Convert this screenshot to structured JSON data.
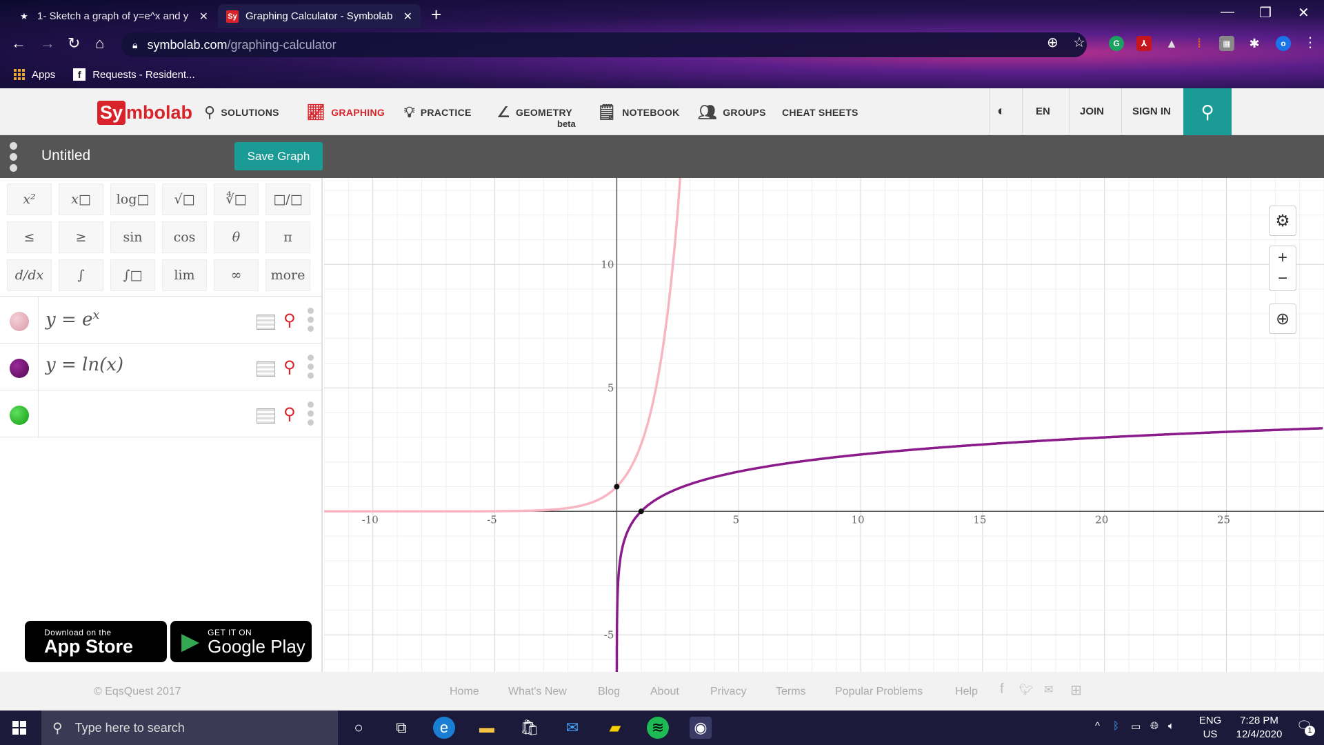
{
  "browser": {
    "tabs": [
      {
        "title": "1- Sketch a graph of y=e^x and y",
        "favicon": "star-icon"
      },
      {
        "title": "Graphing Calculator - Symbolab",
        "favicon": "sy"
      }
    ],
    "url_host": "symbolab.com",
    "url_path": "/graphing-calculator",
    "profile_initial": "o",
    "bookmarks": [
      {
        "label": "Apps"
      },
      {
        "label": "Requests - Resident..."
      }
    ]
  },
  "symbolab": {
    "logo_box": "Sy",
    "logo_rest": "mbolab",
    "nav": [
      {
        "label": "SOLUTIONS",
        "icon": "search-icon"
      },
      {
        "label": "GRAPHING",
        "icon": "graph-icon",
        "active": true
      },
      {
        "label": "PRACTICE",
        "icon": "lightbulb-icon"
      },
      {
        "label": "GEOMETRY",
        "icon": "angle-icon"
      },
      {
        "label": "NOTEBOOK",
        "icon": "notebook-icon"
      },
      {
        "label": "GROUPS",
        "icon": "groups-icon"
      },
      {
        "label": "CHEAT SHEETS",
        "icon": ""
      }
    ],
    "geometry_badge": "beta",
    "lang": "EN",
    "join": "JOIN",
    "signin": "SIGN IN"
  },
  "graph_title": "Untitled",
  "save_label": "Save Graph",
  "keypad": [
    [
      "x²",
      "x□",
      "log□",
      "√□",
      "∜□",
      "□/□"
    ],
    [
      "≤",
      "≥",
      "sin",
      "cos",
      "θ",
      "π"
    ],
    [
      "d/dx",
      "∫",
      "∫□",
      "lim",
      "∞",
      "more"
    ]
  ],
  "expressions": [
    {
      "lhs": "y = e",
      "sup": "x",
      "color": "#e8a9b8"
    },
    {
      "lhs": "y = ln(x)",
      "sup": "",
      "color": "#6b0f6b"
    },
    {
      "lhs": "",
      "sup": "",
      "color": "#22b022"
    }
  ],
  "appstore": {
    "line1": "Download on the",
    "line2": "App Store"
  },
  "googleplay": {
    "line1": "GET IT ON",
    "line2": "Google Play"
  },
  "chart_data": {
    "type": "line",
    "x_range": [
      -12,
      29
    ],
    "y_range": [
      -6.5,
      13.5
    ],
    "x_ticks": [
      -10,
      -5,
      5,
      10,
      15,
      20,
      25
    ],
    "y_ticks": [
      -5,
      5,
      10
    ],
    "grid": true,
    "series": [
      {
        "name": "y=e^x",
        "color": "#f7b6c2",
        "function": "exp"
      },
      {
        "name": "y=ln(x)",
        "color": "#8b1a8b",
        "function": "ln"
      }
    ],
    "points": [
      {
        "x": 0,
        "y": 1
      },
      {
        "x": 1,
        "y": 0
      }
    ]
  },
  "footer": {
    "copyright": "© EqsQuest 2017",
    "links": [
      "Home",
      "What's New",
      "Blog",
      "About",
      "Privacy",
      "Terms",
      "Popular Problems",
      "Help"
    ]
  },
  "taskbar": {
    "search_placeholder": "Type here to search",
    "lang_top": "ENG",
    "lang_bottom": "US",
    "time": "7:28 PM",
    "date": "12/4/2020",
    "notifications": "1"
  }
}
